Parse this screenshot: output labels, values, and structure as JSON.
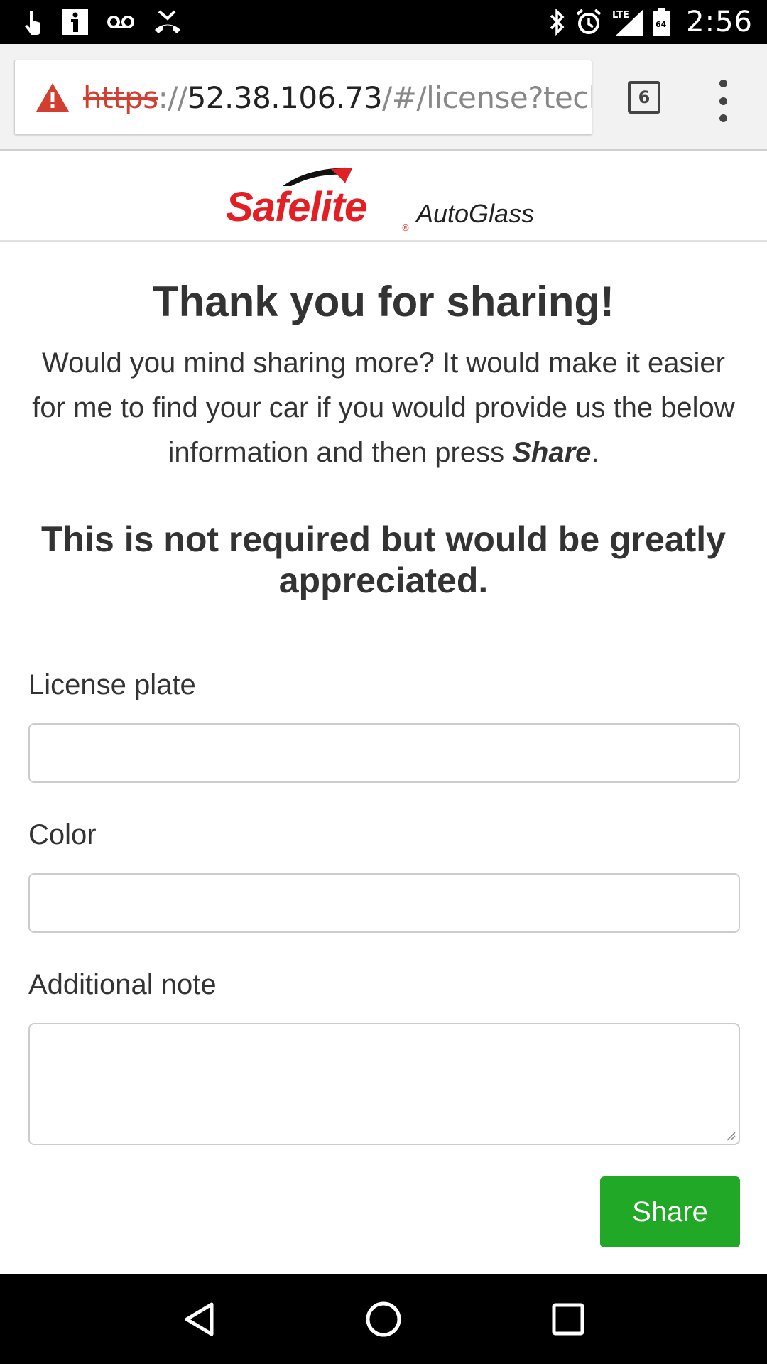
{
  "status_bar": {
    "time": "2:56",
    "icons": [
      "touch-icon",
      "info-icon",
      "voicemail-icon",
      "missed-call-icon",
      "bluetooth-icon",
      "alarm-icon",
      "lte-signal-icon",
      "battery-icon"
    ],
    "lte_label": "LTE",
    "battery_level": "64"
  },
  "browser": {
    "url_scheme": "https",
    "url_sep": "://",
    "url_host": "52.38.106.73",
    "url_path": "/#/license?techF",
    "tab_count": "6",
    "warning_color": "#d23f31"
  },
  "logo": {
    "brand": "Safelite",
    "reg": "®",
    "suffix": "AutoGlass",
    "brand_color": "#e31e24"
  },
  "page": {
    "title": "Thank you for sharing!",
    "intro_before": "Would you mind sharing more? It would make it easier for me to find your car if you would provide us the below information and then press ",
    "intro_emphasis": "Share",
    "intro_after": ".",
    "not_required": "This is not required but would be greatly appreciated."
  },
  "form": {
    "license_label": "License plate",
    "license_value": "",
    "color_label": "Color",
    "color_value": "",
    "note_label": "Additional note",
    "note_value": "",
    "share_label": "Share",
    "share_color": "#21a826"
  },
  "nav_bar": {
    "icons": [
      "back-icon",
      "home-icon",
      "recents-icon"
    ]
  }
}
